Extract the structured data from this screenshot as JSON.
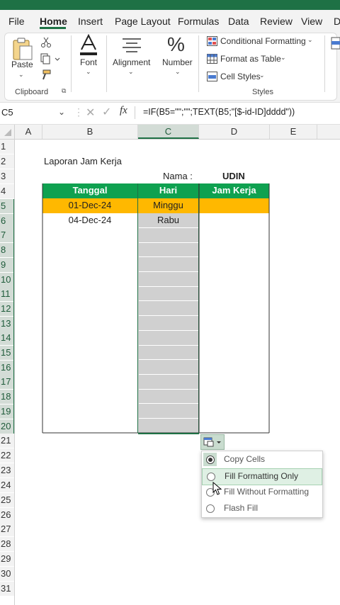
{
  "menu": {
    "tabs": [
      "File",
      "Home",
      "Insert",
      "Page Layout",
      "Formulas",
      "Data",
      "Review",
      "View",
      "D"
    ],
    "active_tab": "Home"
  },
  "ribbon": {
    "clipboard": {
      "paste": "Paste",
      "group": "Clipboard"
    },
    "font": "Font",
    "alignment": "Alignment",
    "number": "Number",
    "styles": {
      "conditional": "Conditional Formatting",
      "format_table": "Format as Table",
      "cell_styles": "Cell Styles",
      "group": "Styles"
    }
  },
  "formula_bar": {
    "name_box": "C5",
    "fx": "fx",
    "formula": "=IF(B5=\"\";\"\";TEXT(B5;\"[$-id-ID]dddd\"))"
  },
  "grid": {
    "columns": [
      "A",
      "B",
      "C",
      "D",
      "E"
    ],
    "rows": [
      "1",
      "2",
      "3",
      "4",
      "5",
      "6",
      "7",
      "8",
      "9",
      "10",
      "11",
      "12",
      "13",
      "14",
      "15",
      "16",
      "17",
      "18",
      "19",
      "20",
      "21",
      "22",
      "23",
      "24",
      "25",
      "26",
      "27",
      "28",
      "29",
      "30",
      "31"
    ]
  },
  "sheet": {
    "title": "Laporan Jam Kerja",
    "nama_label": "Nama :",
    "nama_value": "UDIN",
    "headers": [
      "Tanggal",
      "Hari",
      "Jam Kerja"
    ],
    "row5": [
      "01-Dec-24",
      "Minggu",
      ""
    ],
    "row6": [
      "04-Dec-24",
      "Rabu",
      ""
    ]
  },
  "colors": {
    "excel_green": "#1e7145",
    "header_green": "#0fa150",
    "highlight_orange": "#ffb800",
    "selection_gray": "#d0d0d0"
  },
  "autofill_menu": {
    "options": [
      "Copy Cells",
      "Fill Formatting Only",
      "Fill Without Formatting",
      "Flash Fill"
    ],
    "selected": "Copy Cells",
    "hovered": "Fill Formatting Only"
  }
}
